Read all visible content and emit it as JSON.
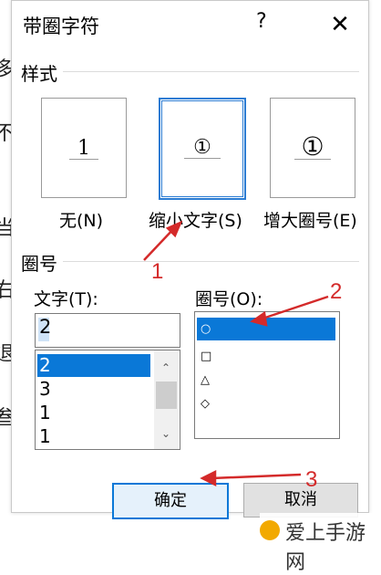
{
  "background": {
    "left_chars": [
      "多",
      "不",
      "当",
      "右",
      "退",
      "叁"
    ],
    "right_chars": [
      "‑"
    ]
  },
  "dialog": {
    "title": "带圈字符",
    "help": "?",
    "close": "✕"
  },
  "style_group": {
    "label": "样式",
    "options": [
      {
        "glyph": "1",
        "label": "无(N)",
        "selected": false
      },
      {
        "glyph": "①",
        "label": "缩小文字(S)",
        "selected": true
      },
      {
        "glyph": "①",
        "label": "增大圈号(E)",
        "selected": false
      }
    ]
  },
  "circle_group": {
    "label": "圈号",
    "text_field": {
      "label": "文字(T):",
      "value": "2",
      "list": [
        "2",
        "3",
        "1",
        "1"
      ],
      "selected_index": 0
    },
    "enclosure_field": {
      "label": "圈号(O):",
      "list": [
        "○",
        "□",
        "△",
        "◇"
      ],
      "selected_index": 0
    }
  },
  "buttons": {
    "ok": "确定",
    "cancel": "取消"
  },
  "annotations": [
    "1",
    "2",
    "3"
  ],
  "colors": {
    "accent": "#0a78d7",
    "annotation": "#d42a2a"
  },
  "watermark": "爱上手游网"
}
